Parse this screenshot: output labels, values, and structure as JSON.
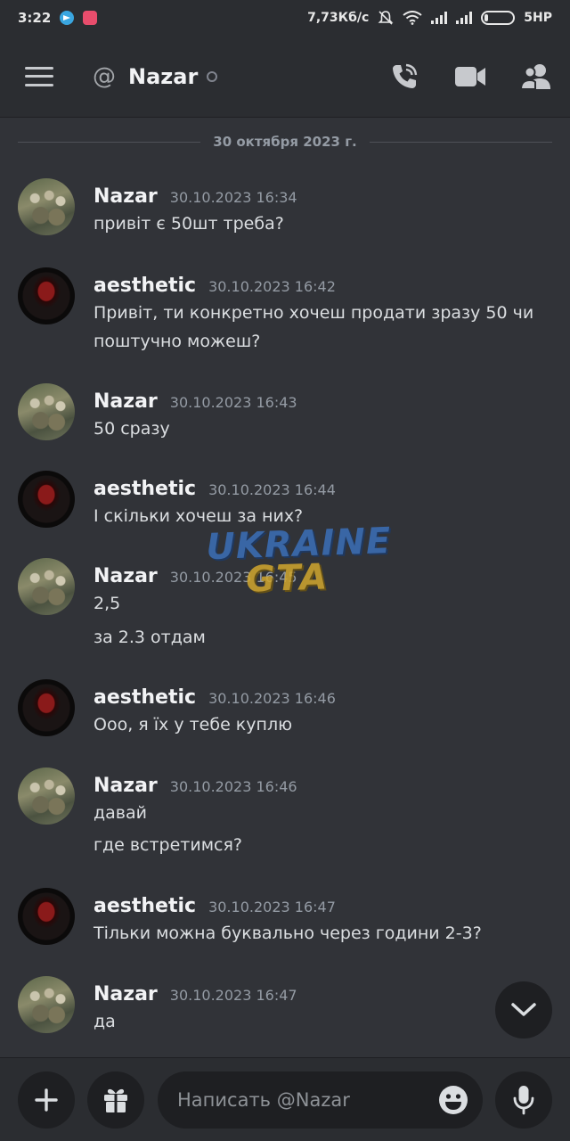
{
  "status_bar": {
    "time": "3:22",
    "net_speed": "7,73Кб/с",
    "carrier": "5HP"
  },
  "header": {
    "at_symbol": "@",
    "title": "Nazar"
  },
  "date_divider": "30 октября 2023 г.",
  "messages": [
    {
      "author": "Nazar",
      "time": "30.10.2023 16:34",
      "lines": [
        "привіт є 50шт треба?"
      ]
    },
    {
      "author": "aesthetic",
      "time": "30.10.2023 16:42",
      "lines": [
        "Привіт, ти конкретно хочеш продати зразу 50 чи",
        "поштучно можеш?"
      ]
    },
    {
      "author": "Nazar",
      "time": "30.10.2023 16:43",
      "lines": [
        "50 сразу"
      ]
    },
    {
      "author": "aesthetic",
      "time": "30.10.2023 16:44",
      "lines": [
        "І скільки хочеш за них?"
      ]
    },
    {
      "author": "Nazar",
      "time": "30.10.2023 16:45",
      "lines": [
        "2,5",
        "за 2.3 отдам"
      ]
    },
    {
      "author": "aesthetic",
      "time": "30.10.2023 16:46",
      "lines": [
        "Ооо, я їх у тебе куплю"
      ]
    },
    {
      "author": "Nazar",
      "time": "30.10.2023 16:46",
      "lines": [
        "давай",
        "где встретимся?"
      ]
    },
    {
      "author": "aesthetic",
      "time": "30.10.2023 16:47",
      "lines": [
        "Тільки можна буквально через години 2-3?"
      ]
    },
    {
      "author": "Nazar",
      "time": "30.10.2023 16:47",
      "lines": [
        "да"
      ]
    }
  ],
  "watermark": {
    "line1": "UKRAINE",
    "line2": "GTA"
  },
  "composer": {
    "placeholder": "Написать @Nazar"
  },
  "icons": {
    "menu": "hamburger-icon",
    "call": "phone-call-icon",
    "video": "video-camera-icon",
    "members": "members-icon",
    "add": "plus-icon",
    "gift": "gift-icon",
    "emoji": "emoji-icon",
    "mic": "microphone-icon",
    "scroll": "chevron-down-icon"
  },
  "colors": {
    "background": "#313338",
    "header": "#2b2d31",
    "input": "#1e1f22",
    "muted_text": "#949ba4"
  }
}
